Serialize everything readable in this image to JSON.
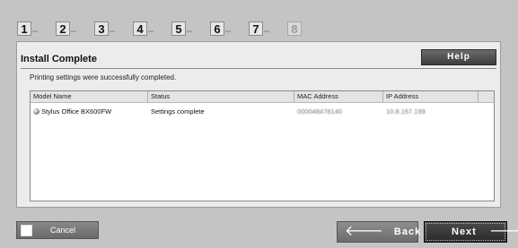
{
  "steps": [
    {
      "num": "1",
      "enabled": true
    },
    {
      "num": "2",
      "enabled": true
    },
    {
      "num": "3",
      "enabled": true
    },
    {
      "num": "4",
      "enabled": true
    },
    {
      "num": "5",
      "enabled": true
    },
    {
      "num": "6",
      "enabled": true
    },
    {
      "num": "7",
      "enabled": true
    },
    {
      "num": "8",
      "enabled": false
    }
  ],
  "panel": {
    "title": "Install Complete",
    "help_label": "Help",
    "message": "Printing settings were successfully completed."
  },
  "table": {
    "headers": [
      "Model Name",
      "Status",
      "MAC Address",
      "IP Address"
    ],
    "rows": [
      {
        "model": "Stylus Office BX600FW",
        "status": "Settings complete",
        "mac": "000048478140",
        "ip": "10.8.167.199"
      }
    ]
  },
  "footer": {
    "cancel_label": "Cancel",
    "back_label": "Back",
    "next_label": "Next"
  }
}
